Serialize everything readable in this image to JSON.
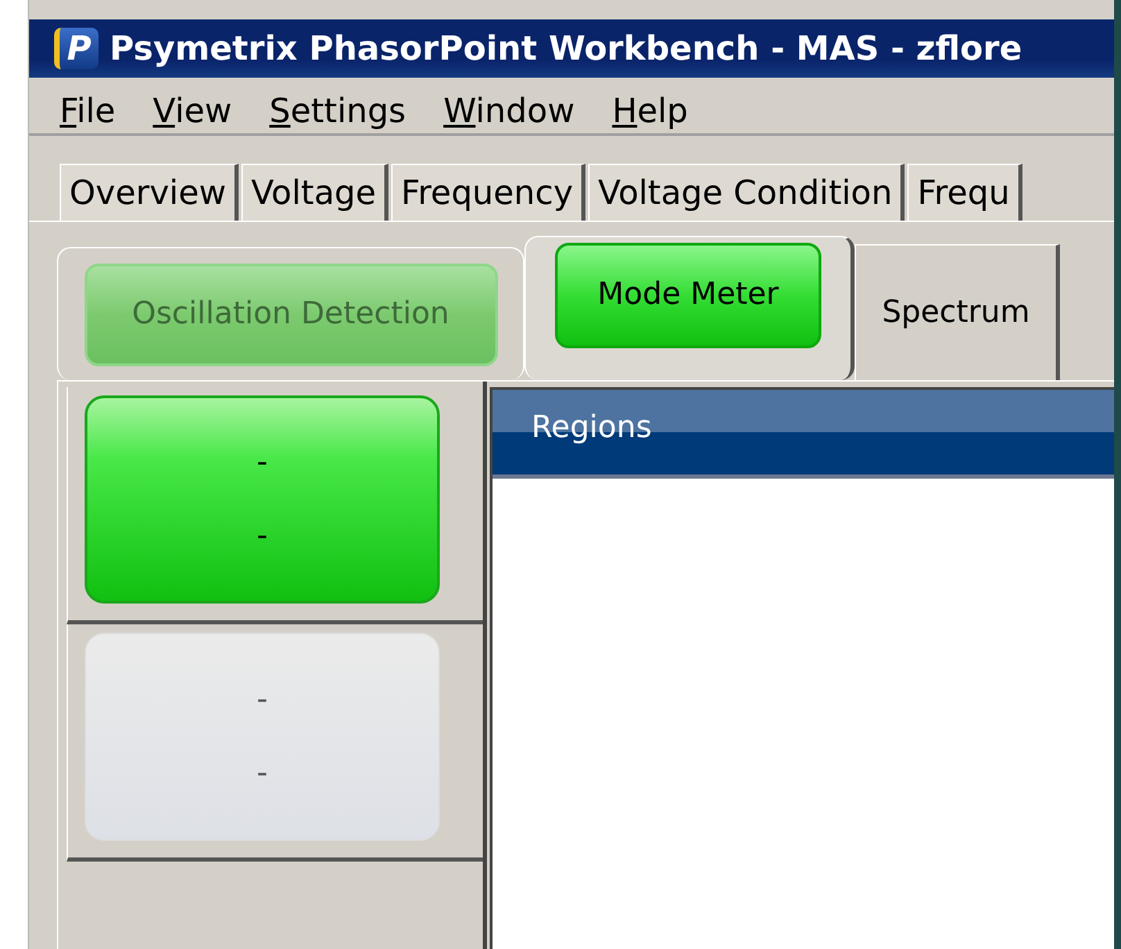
{
  "window": {
    "logo": "P",
    "title": "Psymetrix PhasorPoint Workbench - MAS - zflore"
  },
  "menu": [
    {
      "label": "File"
    },
    {
      "label": "View"
    },
    {
      "label": "Settings"
    },
    {
      "label": "Window"
    },
    {
      "label": "Help"
    }
  ],
  "tabs": [
    {
      "label": "Overview",
      "selected": false
    },
    {
      "label": "Voltage",
      "selected": false
    },
    {
      "label": "Frequency",
      "selected": false
    },
    {
      "label": "Voltage Condition",
      "selected": false
    },
    {
      "label": "Frequ",
      "selected": false
    }
  ],
  "subtabs": [
    {
      "label": "Oscillation Detection",
      "kind": "lamp",
      "selected": false
    },
    {
      "label": "Mode Meter",
      "kind": "lamp",
      "selected": true
    },
    {
      "label": "Spectrum",
      "kind": "plain",
      "selected": false
    }
  ],
  "tiles": [
    {
      "lines": [
        "-",
        "-"
      ],
      "active": true
    },
    {
      "lines": [
        "-",
        "-"
      ],
      "active": false
    }
  ],
  "regions_panel": {
    "title": "Regions"
  }
}
